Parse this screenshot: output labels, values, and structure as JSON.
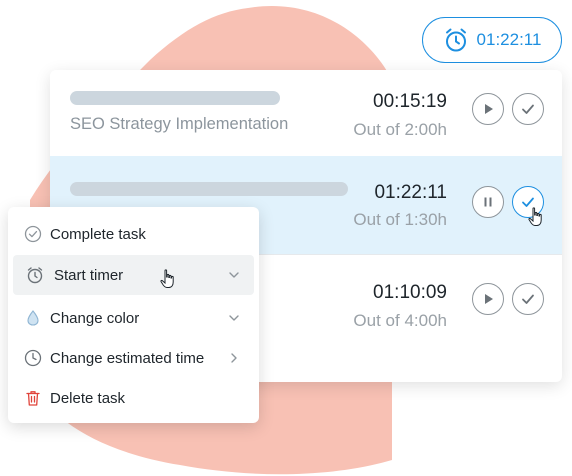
{
  "timer": {
    "value": "01:22:11",
    "icon": "alarm-clock-icon",
    "color": "#1d8fe0"
  },
  "tasks": [
    {
      "name": "SEO Strategy Implementation",
      "time": "00:15:19",
      "estimate": "Out of 2:00h",
      "state": "paused"
    },
    {
      "name": "",
      "time": "01:22:11",
      "estimate": "Out of 1:30h",
      "state": "running"
    },
    {
      "name": "",
      "time": "01:10:09",
      "estimate": "Out of 4:00h",
      "state": "paused"
    }
  ],
  "menu": {
    "items": [
      {
        "label": "Complete task",
        "icon": "check-circle-icon"
      },
      {
        "label": "Start timer",
        "icon": "alarm-clock-icon"
      },
      {
        "label": "Change color",
        "icon": "droplet-icon"
      },
      {
        "label": "Change estimated time",
        "icon": "clock-icon"
      },
      {
        "label": "Delete task",
        "icon": "trash-icon"
      }
    ]
  },
  "colors": {
    "accent": "#1d8fe0",
    "blob": "#f8c1b4",
    "delete": "#e0433a",
    "active_row": "#e1f2fc"
  }
}
